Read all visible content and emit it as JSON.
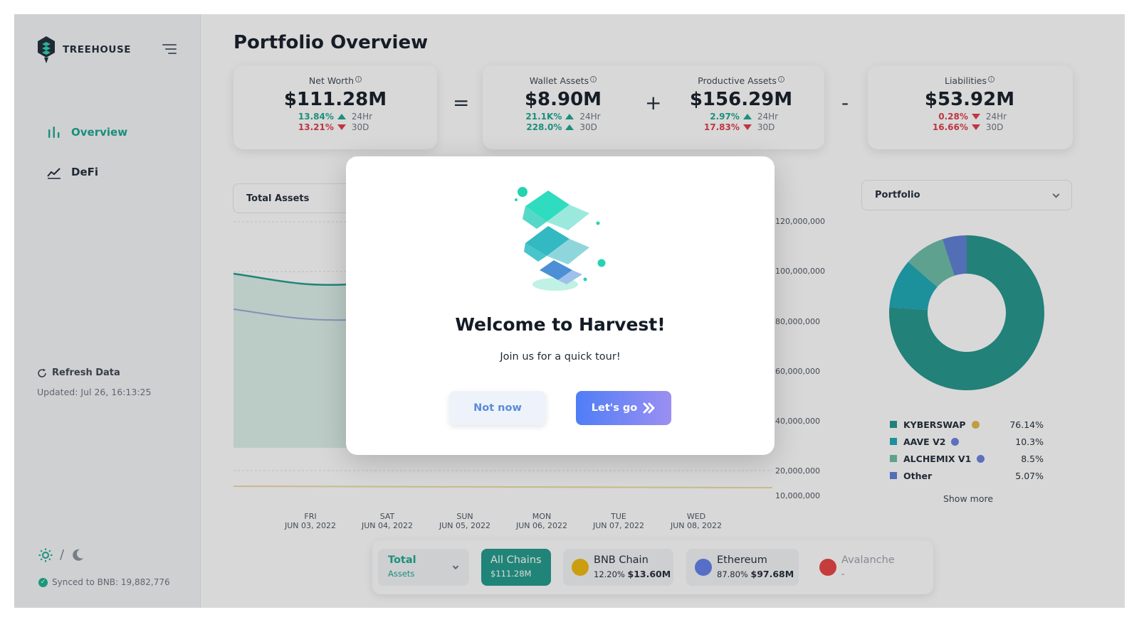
{
  "brand": {
    "name": "TREEHOUSE"
  },
  "sidebar": {
    "items": [
      {
        "label": "Overview",
        "icon": "bar-chart-icon",
        "active": true
      },
      {
        "label": "DeFi",
        "icon": "trend-line-icon",
        "active": false
      }
    ],
    "refresh_label": "Refresh Data",
    "updated_text": "Updated: Jul 26, 16:13:25",
    "theme_separator": "/",
    "synced_text": "Synced to BNB: 19,882,776"
  },
  "page": {
    "title": "Portfolio Overview"
  },
  "metrics": {
    "net_worth": {
      "label": "Net Worth",
      "value": "$111.28M",
      "change_24h": "13.84%",
      "change_30d": "13.21%",
      "dir_24h": "up",
      "dir_30d": "down",
      "period_24h": "24Hr",
      "period_30d": "30D"
    },
    "wallet_assets": {
      "label": "Wallet Assets",
      "value": "$8.90M",
      "change_24h": "21.1K%",
      "change_30d": "228.0%",
      "dir_24h": "up",
      "dir_30d": "up",
      "period_24h": "24Hr",
      "period_30d": "30D"
    },
    "productive_assets": {
      "label": "Productive Assets",
      "value": "$156.29M",
      "change_24h": "2.97%",
      "change_30d": "17.83%",
      "dir_24h": "up",
      "dir_30d": "down",
      "period_24h": "24Hr",
      "period_30d": "30D"
    },
    "liabilities": {
      "label": "Liabilities",
      "value": "$53.92M",
      "change_24h": "0.28%",
      "change_30d": "16.66%",
      "dir_24h": "down",
      "dir_30d": "down",
      "period_24h": "24Hr",
      "period_30d": "30D"
    },
    "operators": {
      "eq": "=",
      "plus": "+",
      "minus": "-"
    }
  },
  "chart": {
    "selector_label": "Total Assets",
    "y_ticks": [
      "120,000,000",
      "100,000,000",
      "80,000,000",
      "60,000,000",
      "40,000,000",
      "20,000,000",
      "10,000,000"
    ],
    "x_ticks": [
      {
        "day": "FRI",
        "date": "JUN 03, 2022"
      },
      {
        "day": "SAT",
        "date": "JUN 04, 2022"
      },
      {
        "day": "SUN",
        "date": "JUN 05, 2022"
      },
      {
        "day": "MON",
        "date": "JUN 06, 2022"
      },
      {
        "day": "TUE",
        "date": "JUN 07, 2022"
      },
      {
        "day": "WED",
        "date": "JUN 08, 2022"
      }
    ],
    "colors": {
      "total": "#1f9a8a",
      "secondary": "#9aa8d8",
      "liability": "#efd9a0"
    }
  },
  "portfolio": {
    "selector_label": "Portfolio",
    "items": [
      {
        "name": "KYBERSWAP",
        "pct": "76.14%",
        "value": 76.14,
        "color": "#21958c",
        "coin_color": "#e0b94a"
      },
      {
        "name": "AAVE V2",
        "pct": "10.3%",
        "value": 10.3,
        "color": "#1aa8b5",
        "coin_color": "#6a7fe0"
      },
      {
        "name": "ALCHEMIX V1",
        "pct": "8.5%",
        "value": 8.5,
        "color": "#6bbca5",
        "coin_color": "#6a7fe0"
      },
      {
        "name": "Other",
        "pct": "5.07%",
        "value": 5.07,
        "color": "#5c7ed4",
        "coin_color": ""
      }
    ],
    "show_more": "Show more"
  },
  "chains": {
    "total": {
      "label": "Total",
      "sub": "Assets"
    },
    "all": {
      "label": "All Chains",
      "value": "$111.28M"
    },
    "bnb": {
      "label": "BNB Chain",
      "pct": "12.20%",
      "value": "$13.60M",
      "color": "#f0b90b"
    },
    "eth": {
      "label": "Ethereum",
      "pct": "87.80%",
      "value": "$97.68M",
      "color": "#627eea"
    },
    "avax": {
      "label": "Avalanche",
      "value": "-",
      "color": "#e84142"
    }
  },
  "modal": {
    "title": "Welcome to Harvest!",
    "subtitle": "Join us for a quick tour!",
    "secondary_label": "Not now",
    "primary_label": "Let's go"
  }
}
